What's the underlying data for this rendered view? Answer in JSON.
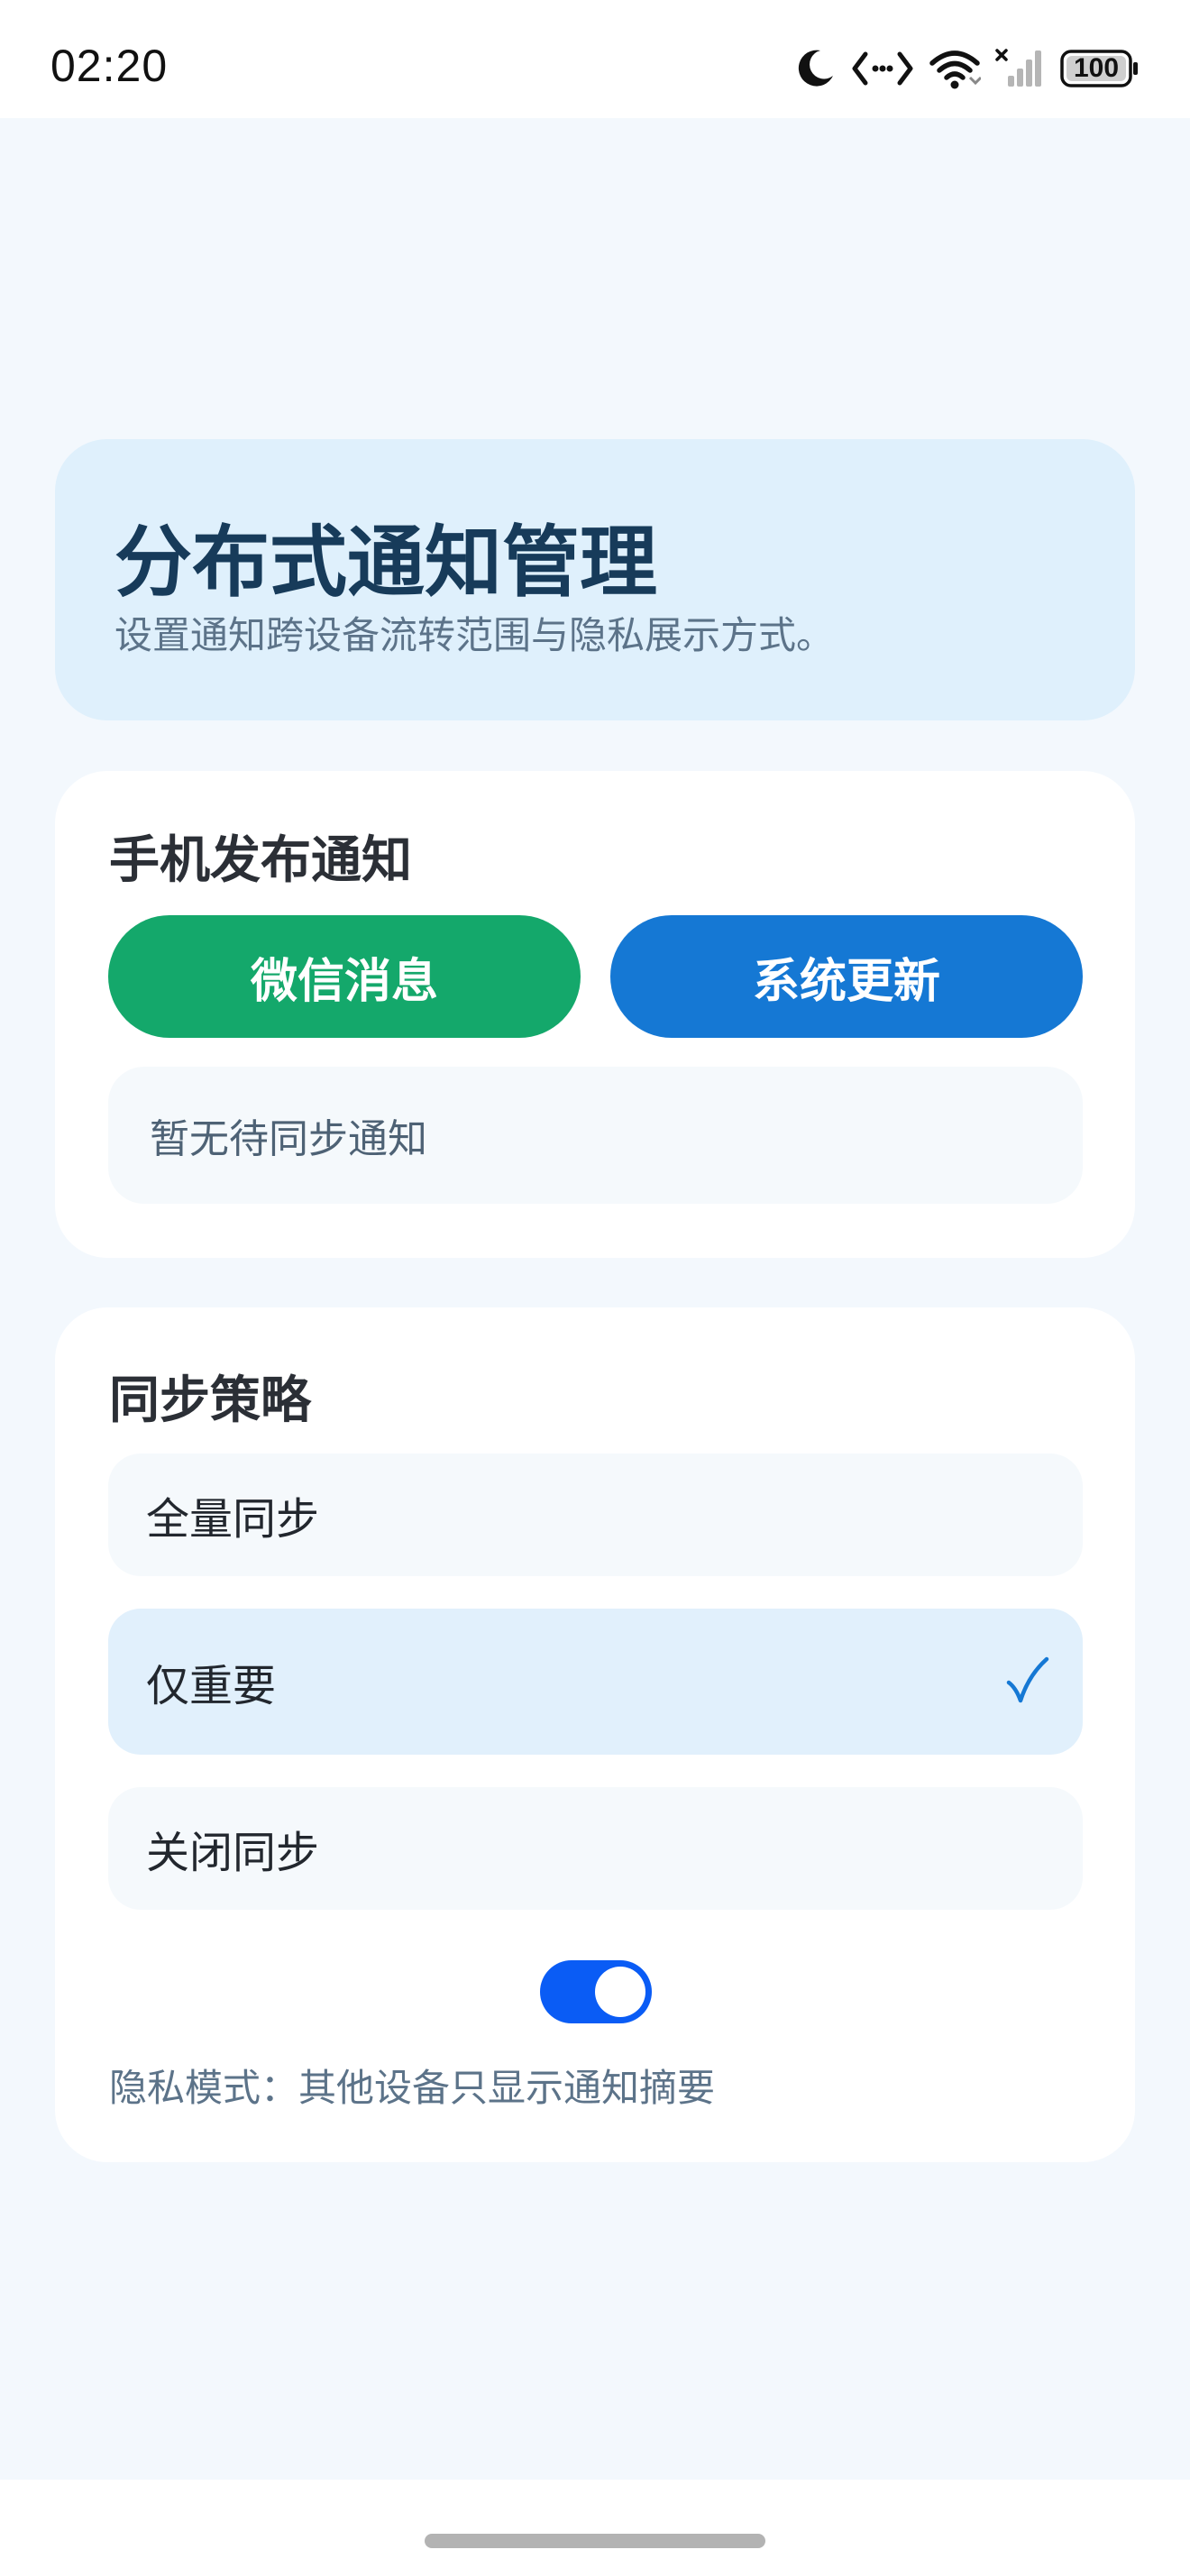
{
  "status_bar": {
    "time": "02:20",
    "battery": "100",
    "icons": [
      "moon-icon",
      "code-arrows-icon",
      "wifi-icon",
      "cellular-no-signal-icon",
      "battery-icon"
    ]
  },
  "header": {
    "title": "分布式通知管理",
    "subtitle": "设置通知跨设备流转范围与隐私展示方式。"
  },
  "phone_notify": {
    "section_title": "手机发布通知",
    "wechat_button": "微信消息",
    "system_button": "系统更新",
    "empty_text": "暂无待同步通知",
    "colors": {
      "wechat": "#14A86B",
      "system": "#1578D4"
    }
  },
  "strategy": {
    "section_title": "同步策略",
    "options": [
      {
        "label": "全量同步",
        "selected": false
      },
      {
        "label": "仅重要",
        "selected": true
      },
      {
        "label": "关闭同步",
        "selected": false
      }
    ],
    "privacy_toggle_on": true,
    "privacy_text": "隐私模式：其他设备只显示通知摘要",
    "accent": "#0A5CF5"
  }
}
